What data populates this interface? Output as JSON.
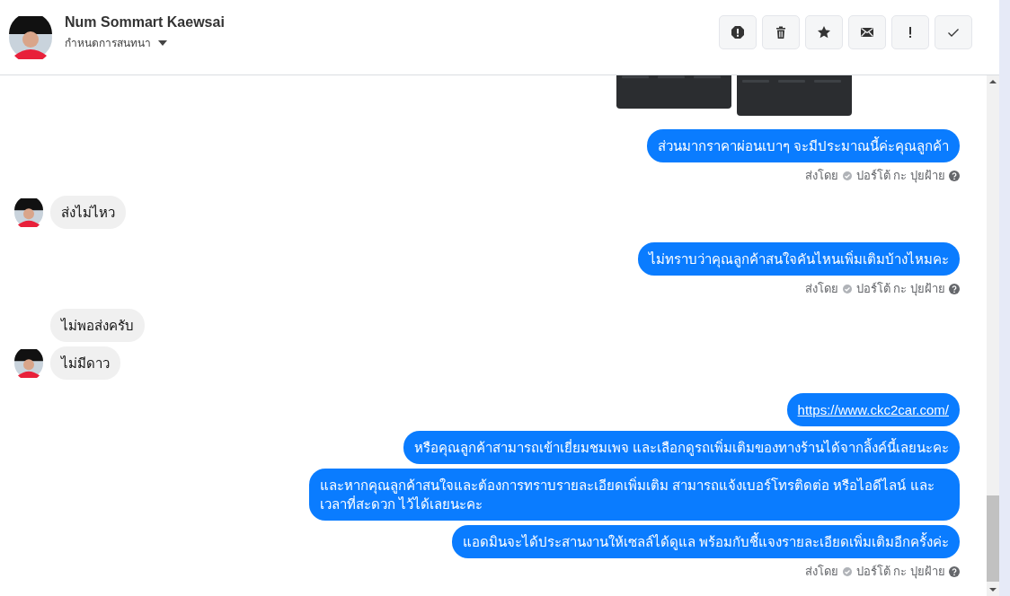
{
  "header": {
    "name": "Num Sommart Kaewsai",
    "subtitle": "กำหนดการสนทนา"
  },
  "groups": [
    {
      "kind": "outgoing",
      "messages": [
        {
          "kind": "images"
        }
      ]
    },
    {
      "kind": "outgoing",
      "messages": [
        {
          "kind": "text",
          "text": "ส่วนมากราคาผ่อนเบาๆ จะมีประมาณนี้ค่ะคุณลูกค้า"
        }
      ],
      "sent_by": {
        "prefix": "ส่งโดย",
        "name": "ปอร์โต้ กะ ปุยฝ้าย"
      }
    },
    {
      "kind": "incoming",
      "messages": [
        {
          "kind": "text",
          "text": "ส่งไม่ไหว"
        }
      ]
    },
    {
      "kind": "outgoing",
      "messages": [
        {
          "kind": "text",
          "text": "ไม่ทราบว่าคุณลูกค้าสนใจคันไหนเพิ่มเติมบ้างไหมคะ"
        }
      ],
      "sent_by": {
        "prefix": "ส่งโดย",
        "name": "ปอร์โต้ กะ ปุยฝ้าย"
      }
    },
    {
      "kind": "incoming",
      "messages": [
        {
          "kind": "text",
          "text": "ไม่พอส่งครับ"
        },
        {
          "kind": "text",
          "text": "ไม่มีดาว"
        }
      ]
    },
    {
      "kind": "outgoing",
      "messages": [
        {
          "kind": "link",
          "text": "https://www.ckc2car.com/"
        },
        {
          "kind": "text",
          "text": "หรือคุณลูกค้าสามารถเข้าเยี่ยมชมเพจ และเลือกดูรถเพิ่มเติมของทางร้านได้จากลิ้งค์นี้เลยนะคะ"
        },
        {
          "kind": "text",
          "text": "และหากคุณลูกค้าสนใจและต้องการทราบรายละเอียดเพิ่มเติม สามารถแจ้งเบอร์โทรติดต่อ หรือไอดีไลน์ และเวลาที่สะดวก ไว้ได้เลยนะคะ"
        },
        {
          "kind": "text",
          "text": "แอดมินจะได้ประสานงานให้เซลล์ได้ดูแล พร้อมกับชี้แจงรายละเอียดเพิ่มเติมอีกครั้งค่ะ"
        }
      ],
      "sent_by": {
        "prefix": "ส่งโดย",
        "name": "ปอร์โต้ กะ ปุยฝ้าย"
      }
    }
  ],
  "toolbar": [
    {
      "kind": "alert"
    },
    {
      "kind": "trash"
    },
    {
      "kind": "star"
    },
    {
      "kind": "mail"
    },
    {
      "kind": "exclaim"
    },
    {
      "kind": "check"
    }
  ]
}
